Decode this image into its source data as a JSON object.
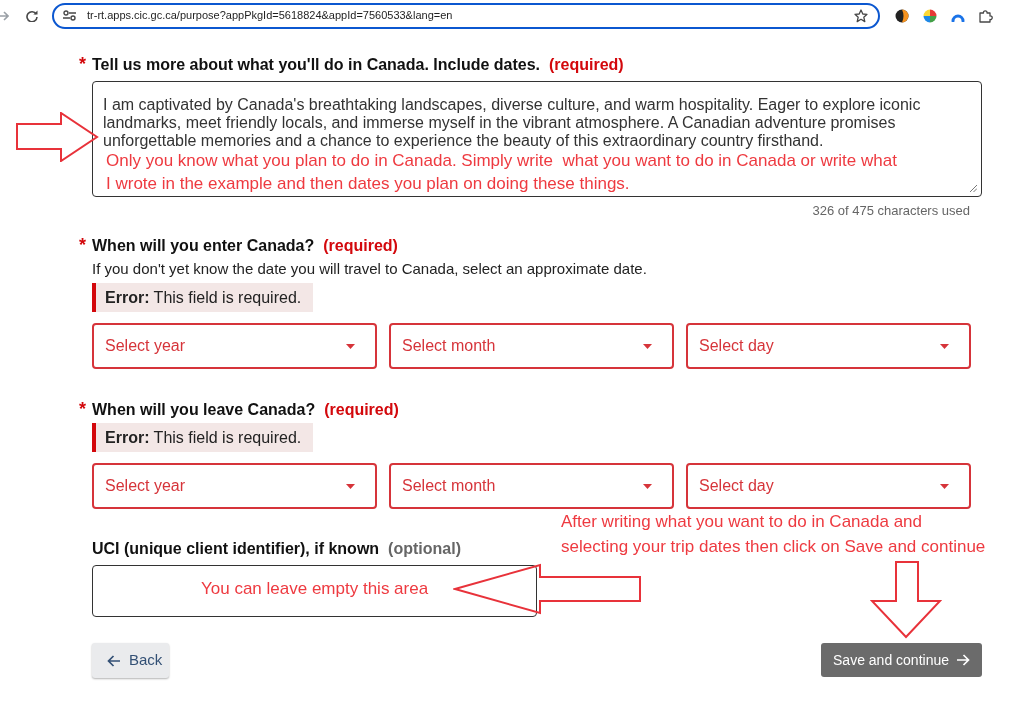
{
  "browser": {
    "url": "tr-rt.apps.cic.gc.ca/purpose?appPkgId=5618824&appId=7560533&lang=en"
  },
  "purpose": {
    "mark": "*",
    "label": "Tell us more about what you'll do in Canada. Include dates.",
    "tag": "(required)",
    "required": true,
    "value": "I am captivated by Canada's breathtaking landscapes, diverse culture, and warm hospitality. Eager to explore iconic landmarks, meet friendly locals, and immerse myself in the vibrant atmosphere. A Canadian adventure promises unforgettable memories and a chance to experience the beauty of this extraordinary country firsthand.",
    "counter": "326 of 475 characters used"
  },
  "entry_date": {
    "mark": "*",
    "label": "When will you enter Canada?",
    "tag": "(required)",
    "required": true,
    "hint": "If you don't yet know the date you will travel to Canada, select an approximate date.",
    "error": "**Error:** This field is required.",
    "selects": [
      {
        "placeholder": "Select year"
      },
      {
        "placeholder": "Select month"
      },
      {
        "placeholder": "Select day"
      }
    ]
  },
  "exit_date": {
    "mark": "*",
    "label": "When will you leave Canada?",
    "tag": "(required)",
    "required": true,
    "error": "**Error:** This field is required.",
    "selects": [
      {
        "placeholder": "Select year"
      },
      {
        "placeholder": "Select month"
      },
      {
        "placeholder": "Select day"
      }
    ]
  },
  "uci": {
    "label": "UCI (unique client identifier), if known",
    "tag": "(optional)",
    "required": false
  },
  "buttons": [
    {
      "kind": "secondary",
      "label": "Back"
    },
    {
      "kind": "primary",
      "label": "Save and continue"
    }
  ],
  "annotations": {
    "purpose_note": {
      "lines": [
        "Only you know what you plan to do in Canada. Simply write  what you want to do in Canada or write what",
        "I wrote in the example and then dates you plan on doing these things."
      ]
    },
    "save_note": {
      "lines": [
        "After writing what you want to do in Canada and",
        "selecting your trip dates then click on Save and continue"
      ]
    },
    "uci_note": {
      "lines": [
        "You can leave empty this area"
      ]
    }
  }
}
